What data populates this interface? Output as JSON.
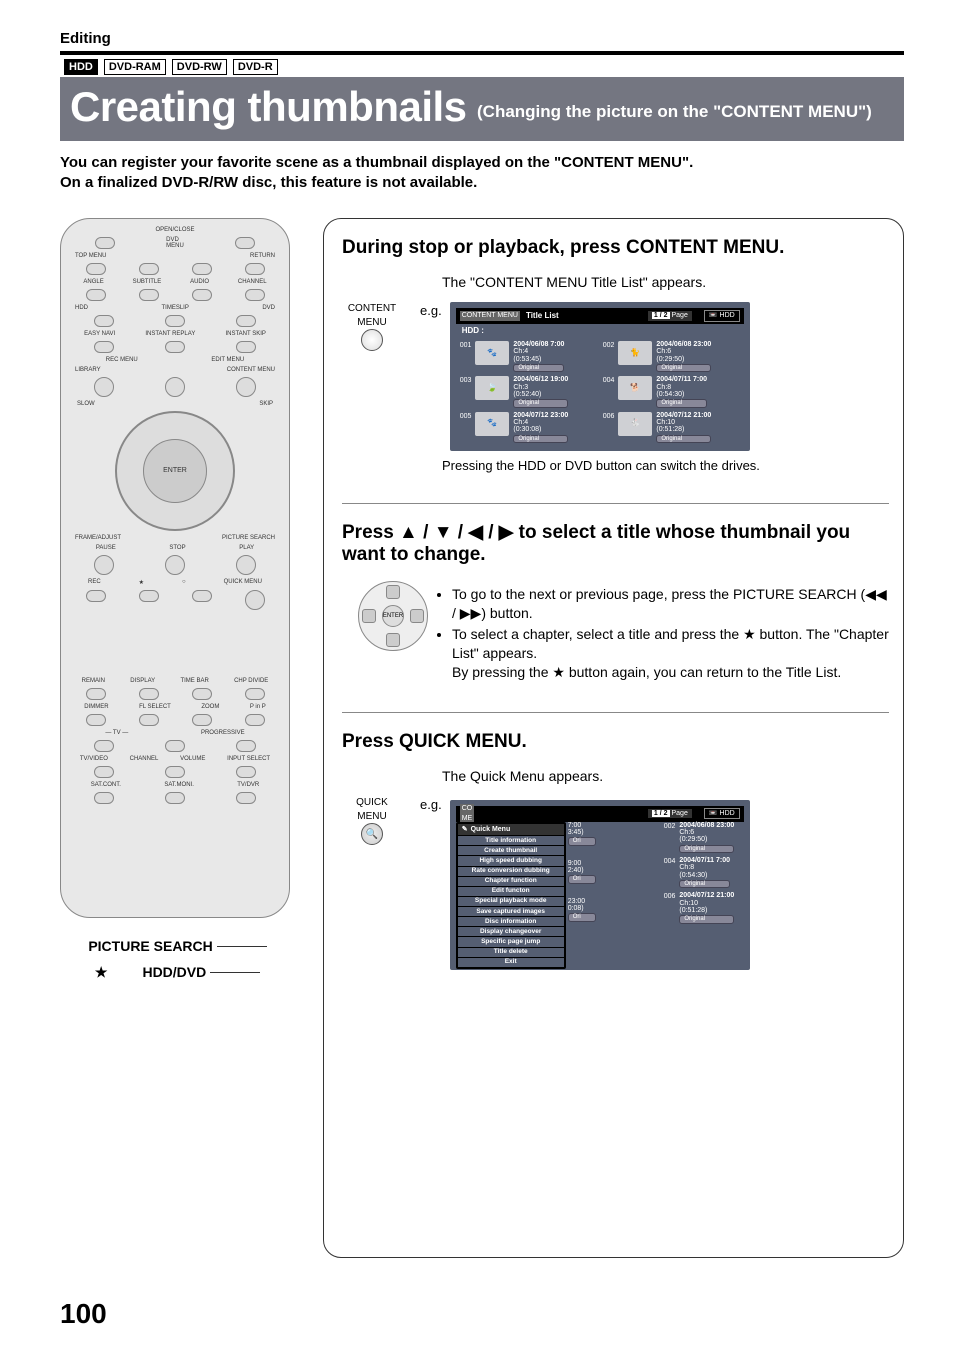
{
  "section_label": "Editing",
  "badges": [
    "HDD",
    "DVD-RAM",
    "DVD-RW",
    "DVD-R"
  ],
  "title_main": "Creating thumbnails",
  "title_sub": "(Changing the picture on the \"CONTENT MENU\")",
  "intro_line1": "You can register your favorite scene as a thumbnail displayed on the \"CONTENT MENU\".",
  "intro_line2": "On a finalized DVD-R/RW disc, this feature is not available.",
  "remote_callouts": {
    "picture_search": "PICTURE SEARCH",
    "hdd_dvd": "HDD/DVD",
    "star_symbol": "★"
  },
  "step1": {
    "title": "During stop or playback, press CONTENT MENU.",
    "appears": "The \"CONTENT MENU Title List\" appears.",
    "btn_label": "CONTENT MENU",
    "eg": "e.g.",
    "note_after": "Pressing the HDD or DVD button can switch the drives.",
    "osd": {
      "logo": "CONTENT MENU",
      "title": "Title List",
      "page_cur": "1 / 2",
      "page_label": "Page",
      "drive": "HDD",
      "subhead": "HDD :",
      "tiles": [
        {
          "id": "001",
          "d": "2004/06/08  7:00",
          "ch": "Ch:4",
          "dur": "(0:53:45)",
          "tag": "Original"
        },
        {
          "id": "002",
          "d": "2004/06/08 23:00",
          "ch": "Ch:6",
          "dur": "(0:29:50)",
          "tag": "Original"
        },
        {
          "id": "003",
          "d": "2004/06/12 19:00",
          "ch": "Ch:3",
          "dur": "(0:52:40)",
          "tag": "Original"
        },
        {
          "id": "004",
          "d": "2004/07/11  7:00",
          "ch": "Ch:8",
          "dur": "(0:54:30)",
          "tag": "Original"
        },
        {
          "id": "005",
          "d": "2004/07/12 23:00",
          "ch": "Ch:4",
          "dur": "(0:30:08)",
          "tag": "Original"
        },
        {
          "id": "006",
          "d": "2004/07/12 21:00",
          "ch": "Ch:10",
          "dur": "(0:51:28)",
          "tag": "Original"
        }
      ]
    }
  },
  "step2": {
    "title_prefix": "Press ",
    "title_arrows": "▲ / ▼ / ◀ / ▶",
    "title_suffix": " to select a title whose thumbnail you want to change.",
    "bullets": {
      "b1_a": "To go to the next or previous page, press the PICTURE SEARCH (",
      "b1_rr": "◀◀",
      "b1_sep": " / ",
      "b1_ff": "▶▶",
      "b1_b": ") button.",
      "b2_a": "To select a chapter, select a title and press the ",
      "b2_star": "★",
      "b2_b": " button. The \"Chapter List\" appears.",
      "b2_c_a": "By pressing the ",
      "b2_c_b": " button again, you can return to the Title List."
    },
    "nav_center": "ENTER"
  },
  "step3": {
    "title": "Press QUICK MENU.",
    "appears": "The Quick Menu appears.",
    "btn_label": "QUICK MENU",
    "eg": "e.g.",
    "qm_title": "Quick Menu",
    "qm_items": [
      "Title information",
      "Create thumbnail",
      "High speed dubbing",
      "Rate conversion dubbing",
      "Chapter function",
      "Edit functon",
      "Special playback mode",
      "Save captured images",
      "Disc information",
      "Display changeover",
      "Specific page jump",
      "Title delete",
      "Exit"
    ],
    "osd": {
      "page_cur": "1 / 2",
      "page_label": "Page",
      "drive": "HDD",
      "peek": [
        {
          "t": "7:00",
          "d": "3:45)"
        },
        {
          "t": "9:00",
          "d": "2:40)"
        },
        {
          "t": "23:00",
          "d": "0:08)"
        }
      ],
      "right_tiles": [
        {
          "id": "002",
          "d": "2004/06/08 23:00",
          "ch": "Ch:6",
          "dur": "(0:29:50)",
          "tag": "Original"
        },
        {
          "id": "004",
          "d": "2004/07/11  7:00",
          "ch": "Ch:8",
          "dur": "(0:54:30)",
          "tag": "Original"
        },
        {
          "id": "006",
          "d": "2004/07/12 21:00",
          "ch": "Ch:10",
          "dur": "(0:51:28)",
          "tag": "Original"
        }
      ]
    }
  },
  "page_number": "100"
}
